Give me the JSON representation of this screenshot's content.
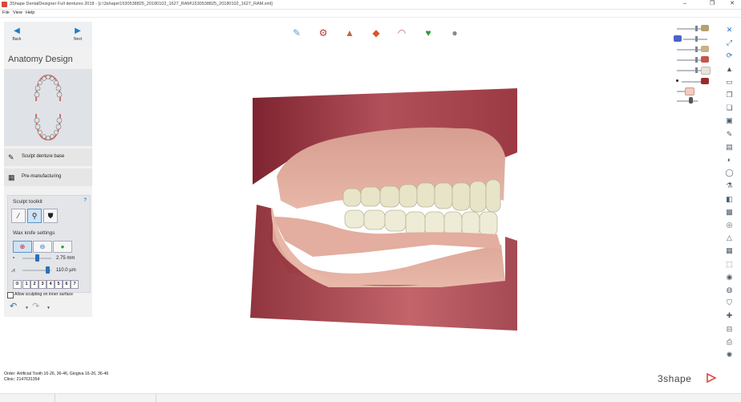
{
  "window": {
    "title": "3Shape DentalDesigner Full dentures 2018 - [c:\\3shape\\1530538825_20180102_1627_RAM\\1530538825_20180102_1627_RAM.xml]",
    "controls": [
      "–",
      "❐",
      "✕"
    ]
  },
  "menu": [
    "File",
    "View",
    "Help"
  ],
  "nav": {
    "back": "Back",
    "next": "Next"
  },
  "step_title": "Anatomy Design",
  "steps": [
    {
      "label": "Sculpt denture base",
      "icon": "sculpt-denture-icon"
    },
    {
      "label": "Pre-manufacturing",
      "icon": "pre-manufacturing-icon"
    }
  ],
  "sculpt_toolkit": {
    "header": "Sculpt toolkit",
    "help": "?",
    "tools": [
      "wax-knife-tool-icon",
      "smooth-tool-icon",
      "morph-tool-icon"
    ]
  },
  "wax_knife": {
    "header": "Wax knife settings",
    "modes": [
      "add-wax-icon",
      "remove-wax-icon",
      "smooth-wax-icon"
    ],
    "radius": {
      "value": "2.75 mm",
      "level": 0.5
    },
    "depth": {
      "value": "110.0 µm",
      "level": 0.95
    },
    "presets": [
      "1",
      "2",
      "3",
      "4",
      "5",
      "6",
      "7"
    ]
  },
  "allow_inner": {
    "label": "Allow sculpting on inner surface",
    "checked": false
  },
  "top_toolbar": [
    "knife-tool-icon",
    "articulator-icon",
    "tooth-library-icon",
    "color-map-icon",
    "gingiva-icon",
    "shield-icon",
    "sphere-icon"
  ],
  "visibility_panel": [
    {
      "name": "upper-base",
      "color": "#b7a070",
      "level": 0.95
    },
    {
      "name": "lower-teeth",
      "color": "#4b63c8",
      "level": 0.95
    },
    {
      "name": "upper-teeth",
      "color": "#c9b183",
      "level": 0.95
    },
    {
      "name": "gingiva",
      "color": "#c6554a",
      "level": 0.95
    },
    {
      "name": "teeth-white",
      "color": "#e8e4d8",
      "level": 0.95
    },
    {
      "name": "jaw-dark",
      "color": "#9d2a2a",
      "level": 0.95
    },
    {
      "name": "tooth-single",
      "color": "#f0ccc0",
      "level": 0.6
    },
    {
      "name": "antagonist",
      "color": "#555555",
      "level": 0.5
    }
  ],
  "right_toolbar": [
    "close-view-icon",
    "fullscreen-icon",
    "rotate-icon",
    "education-icon",
    "window-icon",
    "copy-view-icon",
    "paste-view-icon",
    "snapshot-icon",
    "crown-icon",
    "stack-icon",
    "palette-icon",
    "clip-icon",
    "transparent-icon",
    "occlusion-icon",
    "cube-icon",
    "section-icon",
    "dim-icon",
    "measure-icon",
    "grid-icon",
    "camera-icon",
    "ring-icon",
    "shield-view-icon",
    "cross-icon",
    "ruler-icon",
    "print-icon",
    "color-wheel-icon"
  ],
  "order": {
    "order_line": "Order:   Artificial Tooth 16-26, 36-46, Gingiva 16-26, 36-46",
    "clinic_line": "Clinic:   2147631354"
  },
  "brand": "3shape"
}
